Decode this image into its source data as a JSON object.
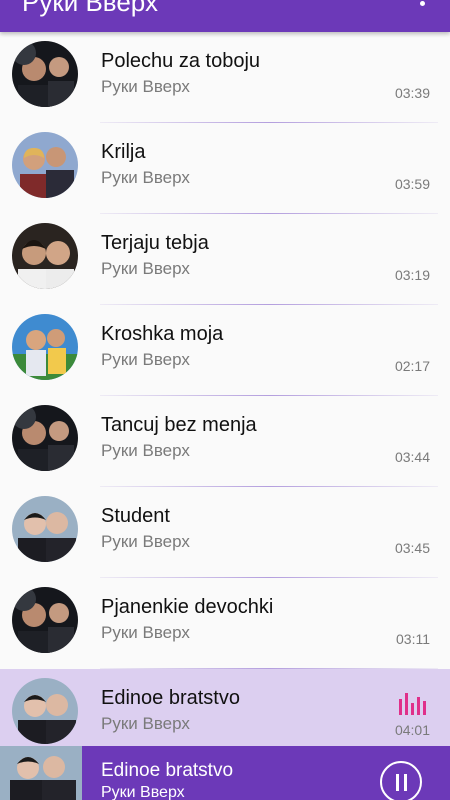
{
  "appbar": {
    "title": "Руки Вверх"
  },
  "tracks": [
    {
      "title": "Polechu za toboju",
      "artist": "Руки Вверх",
      "duration": "03:39"
    },
    {
      "title": "Krilja",
      "artist": "Руки Вверх",
      "duration": "03:59"
    },
    {
      "title": "Terjaju tebja",
      "artist": "Руки Вверх",
      "duration": "03:19"
    },
    {
      "title": "Kroshka moja",
      "artist": "Руки Вверх",
      "duration": "02:17"
    },
    {
      "title": "Tancuj bez menja",
      "artist": "Руки Вверх",
      "duration": "03:44"
    },
    {
      "title": "Student",
      "artist": "Руки Вверх",
      "duration": "03:45"
    },
    {
      "title": "Pjanenkie devochki",
      "artist": "Руки Вверх",
      "duration": "03:11"
    },
    {
      "title": "Edinoe bratstvo",
      "artist": "Руки Вверх",
      "duration": "04:01",
      "playing": true
    }
  ],
  "now_playing": {
    "title": "Edinoe bratstvo",
    "artist": "Руки Вверх"
  },
  "icons": {
    "overflow": "more-vert-icon",
    "equalizer": "equalizer-icon",
    "pause": "pause-icon"
  },
  "colors": {
    "primary": "#6c39b8",
    "active_row": "#dccff0",
    "equalizer": "#e0308a"
  }
}
